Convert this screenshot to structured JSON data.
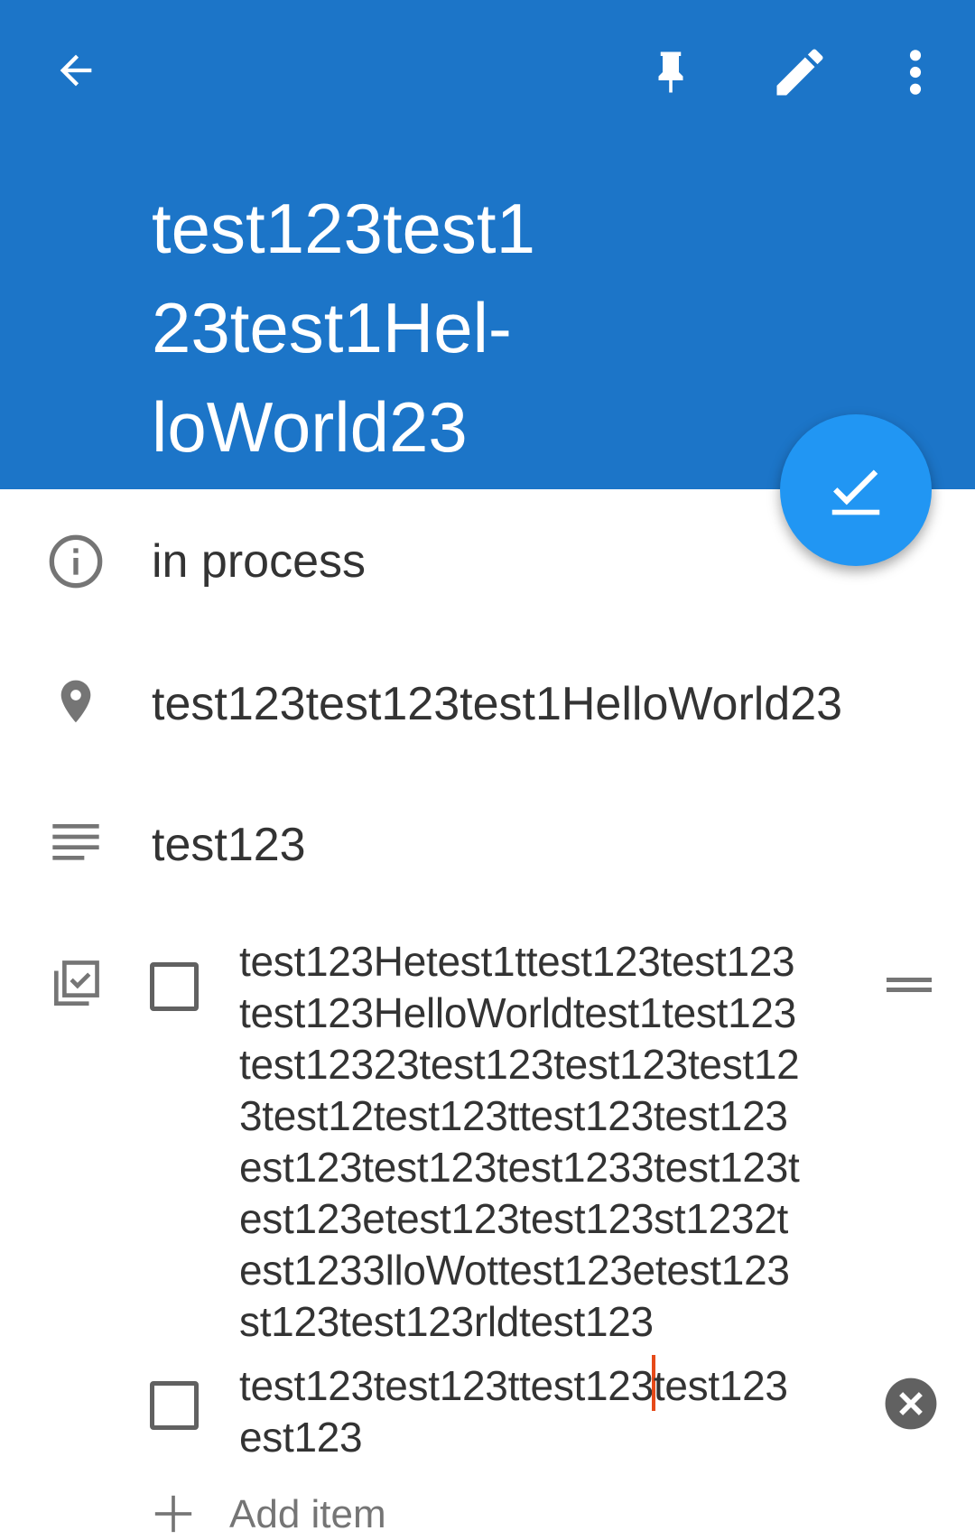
{
  "toolbar": {
    "back_icon": "arrow-left-icon",
    "pin_icon": "pin-icon",
    "edit_icon": "pencil-icon",
    "more_icon": "more-vert-icon"
  },
  "note": {
    "title": "test123test1\n23test1Hel-\nloWorld23",
    "status": "in process",
    "location": "test123test123test1HelloWorld23",
    "description": "test123"
  },
  "checklist": {
    "items": [
      {
        "text": "test123Hetest1ttest123test123\ntest123HelloWorldtest1test123\ntest12323test123test123test12\n3test12test123ttest123test123\nest123test123test1233test123t\nest123etest123test123st1232t\nest1233lloWottest123etest123\nst123test123rldtest123",
        "checked": false
      },
      {
        "text_before_cursor": "test123test123ttest123",
        "text_after_cursor": "test123\nest123",
        "checked": false
      }
    ],
    "add_item_label": "Add item"
  },
  "colors": {
    "header": "#1c75c8",
    "fab": "#2196f3",
    "cursor": "#e64a19"
  }
}
